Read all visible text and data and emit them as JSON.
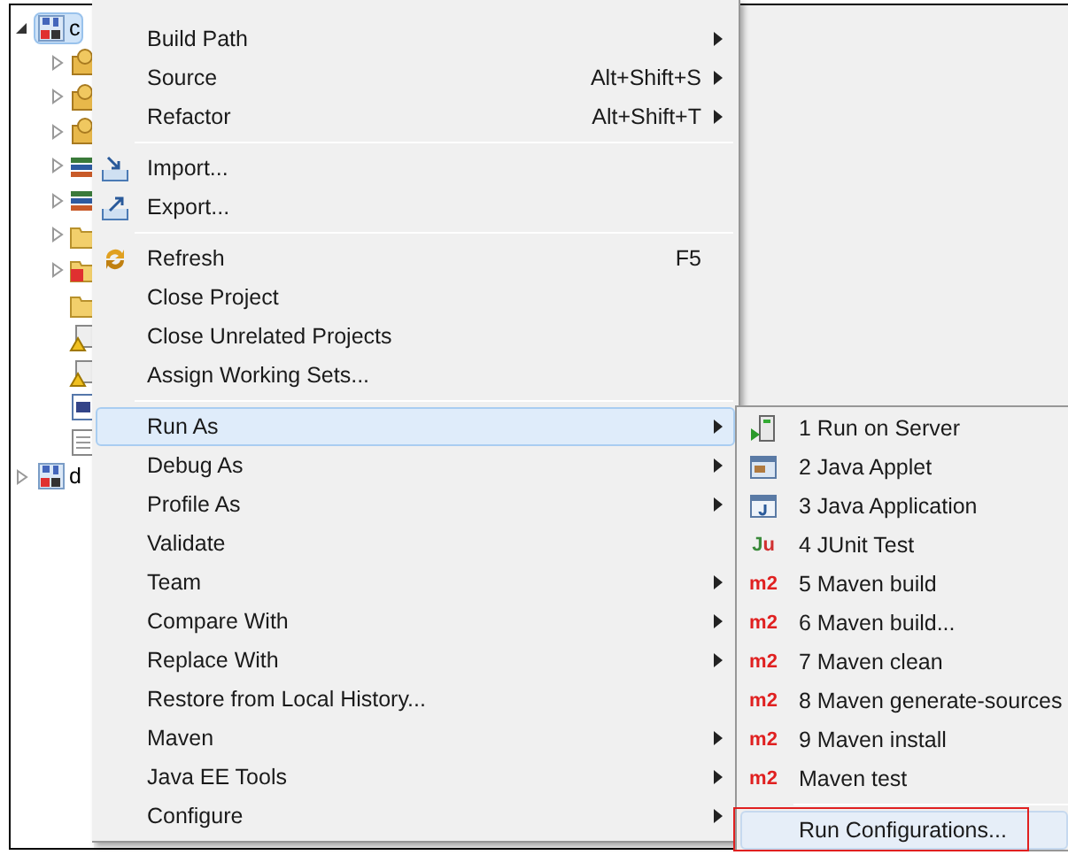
{
  "tree": {
    "items": [
      {
        "label": "c",
        "kind": "project",
        "expanded": true,
        "selected": true,
        "children": [
          {
            "kind": "config",
            "expandable": true
          },
          {
            "kind": "config",
            "expandable": true
          },
          {
            "kind": "config",
            "expandable": true
          },
          {
            "kind": "library",
            "expandable": true
          },
          {
            "kind": "library",
            "expandable": true
          },
          {
            "kind": "folder",
            "expandable": true
          },
          {
            "kind": "error-folder",
            "expandable": true
          },
          {
            "kind": "folder",
            "expandable": false
          },
          {
            "kind": "warning-file",
            "expandable": false
          },
          {
            "kind": "warning-file",
            "expandable": false
          },
          {
            "kind": "xml-file",
            "expandable": false
          },
          {
            "kind": "text-file",
            "expandable": false
          }
        ]
      },
      {
        "label": "d",
        "kind": "project",
        "expanded": false,
        "selected": false
      }
    ]
  },
  "context_menu": {
    "items": [
      {
        "kind": "item",
        "label": "Build Path",
        "has_submenu": true,
        "selected": false
      },
      {
        "kind": "item",
        "label": "Source",
        "shortcut": "Alt+Shift+S",
        "has_submenu": true,
        "selected": false
      },
      {
        "kind": "item",
        "label": "Refactor",
        "shortcut": "Alt+Shift+T",
        "has_submenu": true,
        "selected": false
      },
      {
        "kind": "separator"
      },
      {
        "kind": "import",
        "label": "Import...",
        "has_submenu": false,
        "selected": false
      },
      {
        "kind": "export",
        "label": "Export...",
        "has_submenu": false,
        "selected": false
      },
      {
        "kind": "separator"
      },
      {
        "kind": "refresh",
        "label": "Refresh",
        "shortcut": "F5",
        "has_submenu": false,
        "selected": false
      },
      {
        "kind": "item",
        "label": "Close Project",
        "has_submenu": false,
        "selected": false
      },
      {
        "kind": "item",
        "label": "Close Unrelated Projects",
        "has_submenu": false,
        "selected": false
      },
      {
        "kind": "item",
        "label": "Assign Working Sets...",
        "has_submenu": false,
        "selected": false
      },
      {
        "kind": "separator"
      },
      {
        "kind": "item",
        "label": "Run As",
        "has_submenu": true,
        "selected": true
      },
      {
        "kind": "item",
        "label": "Debug As",
        "has_submenu": true,
        "selected": false
      },
      {
        "kind": "item",
        "label": "Profile As",
        "has_submenu": true,
        "selected": false
      },
      {
        "kind": "item",
        "label": "Validate",
        "has_submenu": false,
        "selected": false
      },
      {
        "kind": "item",
        "label": "Team",
        "has_submenu": true,
        "selected": false
      },
      {
        "kind": "item",
        "label": "Compare With",
        "has_submenu": true,
        "selected": false
      },
      {
        "kind": "item",
        "label": "Replace With",
        "has_submenu": true,
        "selected": false
      },
      {
        "kind": "item",
        "label": "Restore from Local History...",
        "has_submenu": false,
        "selected": false
      },
      {
        "kind": "item",
        "label": "Maven",
        "has_submenu": true,
        "selected": false
      },
      {
        "kind": "item",
        "label": "Java EE Tools",
        "has_submenu": true,
        "selected": false
      },
      {
        "kind": "item",
        "label": "Configure",
        "has_submenu": true,
        "selected": false
      }
    ]
  },
  "run_as_submenu": {
    "items": [
      {
        "kind": "server",
        "label": "1 Run on Server",
        "selected": false,
        "annotated": false
      },
      {
        "kind": "applet",
        "label": "2 Java Applet",
        "selected": false,
        "annotated": false
      },
      {
        "kind": "application",
        "label": "3 Java Application",
        "selected": false,
        "annotated": false
      },
      {
        "kind": "junit",
        "label": "4 JUnit Test",
        "badge": "Ju",
        "selected": false,
        "annotated": false
      },
      {
        "kind": "maven",
        "label": "5 Maven build",
        "badge": "m2",
        "selected": false,
        "annotated": false
      },
      {
        "kind": "maven",
        "label": "6 Maven build...",
        "badge": "m2",
        "selected": false,
        "annotated": false
      },
      {
        "kind": "maven",
        "label": "7 Maven clean",
        "badge": "m2",
        "selected": false,
        "annotated": false
      },
      {
        "kind": "maven",
        "label": "8 Maven generate-sources",
        "badge": "m2",
        "selected": false,
        "annotated": false
      },
      {
        "kind": "maven",
        "label": "9 Maven install",
        "badge": "m2",
        "selected": false,
        "annotated": false
      },
      {
        "kind": "maven",
        "label": "Maven test",
        "badge": "m2",
        "selected": false,
        "annotated": false
      },
      {
        "kind": "separator"
      },
      {
        "kind": "item",
        "label": "Run Configurations...",
        "selected": true,
        "annotated": true
      }
    ]
  }
}
